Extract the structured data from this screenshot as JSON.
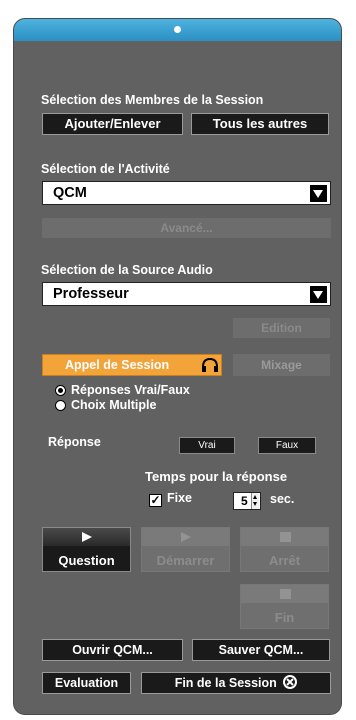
{
  "members": {
    "title": "Sélection des Membres de la Session",
    "add_remove": "Ajouter/Enlever",
    "all_others": "Tous les autres"
  },
  "activity": {
    "title": "Sélection de l'Activité",
    "selected": "QCM",
    "advanced": "Avancé..."
  },
  "audio": {
    "title": "Sélection de la Source Audio",
    "selected": "Professeur",
    "edit": "Edition"
  },
  "session_call": {
    "label": "Appel de Session",
    "icon": "headphones-icon"
  },
  "mix": "Mixage",
  "answer_type": {
    "options": [
      "Réponses Vrai/Faux",
      "Choix Multiple"
    ],
    "selected_index": 0
  },
  "response": {
    "label": "Réponse",
    "true_btn": "Vrai",
    "false_btn": "Faux"
  },
  "timer": {
    "title": "Temps pour la réponse",
    "fixed_label": "Fixe",
    "fixed_checked": true,
    "seconds": "5",
    "unit": "sec."
  },
  "controls": {
    "question": "Question",
    "start": "Démarrer",
    "stop": "Arrêt",
    "end": "Fin"
  },
  "footer": {
    "open": "Ouvrir QCM...",
    "save": "Sauver QCM...",
    "evaluation": "Evaluation",
    "end_session": "Fin de la Session"
  },
  "colors": {
    "title_bar": "#2a8fc2",
    "panel": "#616161",
    "accent": "#f2a33a"
  }
}
